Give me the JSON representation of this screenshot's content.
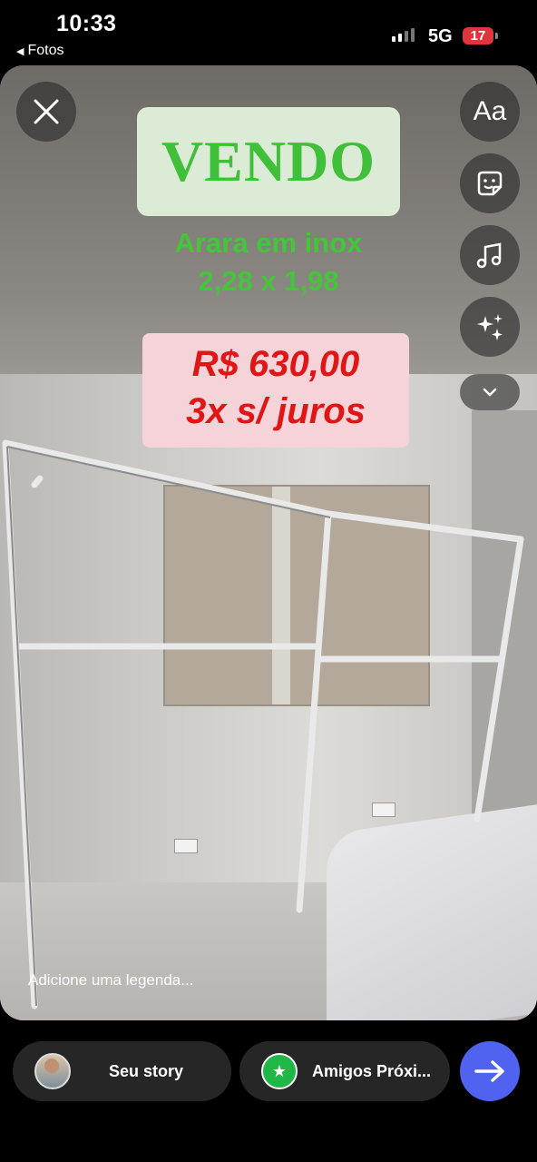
{
  "status_bar": {
    "time": "10:33",
    "back_label": "Fotos",
    "network": "5G",
    "battery": "17"
  },
  "story": {
    "headline": "VENDO",
    "product_line1": "Arara em inox",
    "product_line2": "2,28 x 1,98",
    "price_line1": "R$ 630,00",
    "price_line2": "3x s/ juros",
    "caption_placeholder": "Adicione uma legenda..."
  },
  "toolbar": {
    "text_tool_label": "Aa",
    "icons": [
      "close-icon",
      "sticker-icon",
      "music-icon",
      "sparkles-icon",
      "chevron-down-icon"
    ]
  },
  "bottom_bar": {
    "your_story_label": "Seu story",
    "close_friends_label": "Amigos Próxi..."
  },
  "colors": {
    "headline_green": "#3fbf3a",
    "price_red": "#e01515",
    "send_blue": "#4f63f0",
    "close_friends_green": "#1fb847"
  }
}
